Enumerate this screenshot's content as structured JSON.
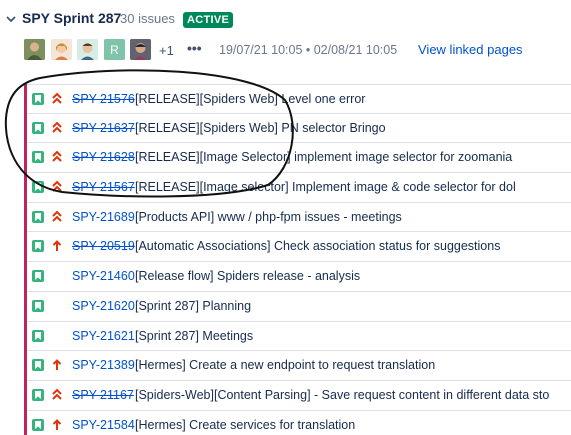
{
  "sprint": {
    "title": "SPY Sprint 287",
    "issue_count": "30 issues",
    "status_badge": "ACTIVE",
    "more_assignees": "+1",
    "more_actions": "•••",
    "date_range": "19/07/21 10:05  •  02/08/21 10:05",
    "linked_pages_label": "View linked pages"
  },
  "colors": {
    "epic_bar": "#c1235e",
    "story_icon": "#36b37e",
    "priority_high": "#de350b",
    "link": "#0052cc",
    "badge": "#00875a"
  },
  "issues": [
    {
      "key": "SPY-21576",
      "done": true,
      "priority": "highest",
      "summary": "[RELEASE][Spiders Web] Level one error"
    },
    {
      "key": "SPY-21637",
      "done": true,
      "priority": "highest",
      "summary": "[RELEASE][Spiders Web] PN selector Bringo"
    },
    {
      "key": "SPY-21628",
      "done": true,
      "priority": "highest",
      "summary": "[RELEASE][Image Selector] implement image selector for zoomania"
    },
    {
      "key": "SPY-21567",
      "done": true,
      "priority": "highest",
      "summary": "[RELEASE][Image selector] Implement image & code selector for dol"
    },
    {
      "key": "SPY-21689",
      "done": false,
      "priority": "highest",
      "summary": "[Products API] www / php-fpm issues - meetings"
    },
    {
      "key": "SPY-20519",
      "done": true,
      "priority": "high",
      "summary": "[Automatic Associations] Check association status for suggestions"
    },
    {
      "key": "SPY-21460",
      "done": false,
      "priority": "none",
      "summary": "[Release flow] Spiders release - analysis"
    },
    {
      "key": "SPY-21620",
      "done": false,
      "priority": "none",
      "summary": "[Sprint 287] Planning"
    },
    {
      "key": "SPY-21621",
      "done": false,
      "priority": "none",
      "summary": "[Sprint 287] Meetings"
    },
    {
      "key": "SPY-21389",
      "done": false,
      "priority": "high",
      "summary": "[Hermes] Create a new endpoint to request translation"
    },
    {
      "key": "SPY-21167",
      "done": true,
      "priority": "highest",
      "summary": "[Spiders-Web][Content Parsing] - Save request content in different data sto"
    },
    {
      "key": "SPY-21584",
      "done": false,
      "priority": "high",
      "summary": "[Hermes] Create services for translation"
    }
  ]
}
